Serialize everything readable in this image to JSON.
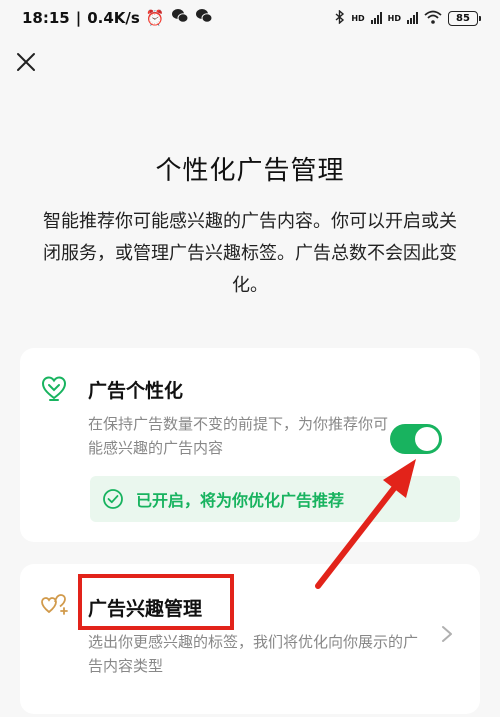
{
  "status_bar": {
    "time": "18:15",
    "speed": "0.4K/s",
    "battery": "85",
    "network_labels": [
      "HD",
      "HD"
    ]
  },
  "page": {
    "title": "个性化广告管理",
    "description": "智能推荐你可能感兴趣的广告内容。你可以开启或关闭服务，或管理广告兴趣标签。广告总数不会因此变化。"
  },
  "personalization_card": {
    "icon": "heart-location-icon",
    "title": "广告个性化",
    "description": "在保持广告数量不变的前提下，为你推荐你可能感兴趣的广告内容",
    "toggle_on": true,
    "status_text": "已开启，将为你优化广告推荐"
  },
  "interest_card": {
    "icon": "hearts-add-icon",
    "title": "广告兴趣管理",
    "description": "选出你更感兴趣的标签，我们将优化向你展示的广告内容类型"
  },
  "colors": {
    "accent": "#18b35f",
    "annotation": "#e2231a",
    "background": "#f7f7f7",
    "card": "#ffffff"
  }
}
